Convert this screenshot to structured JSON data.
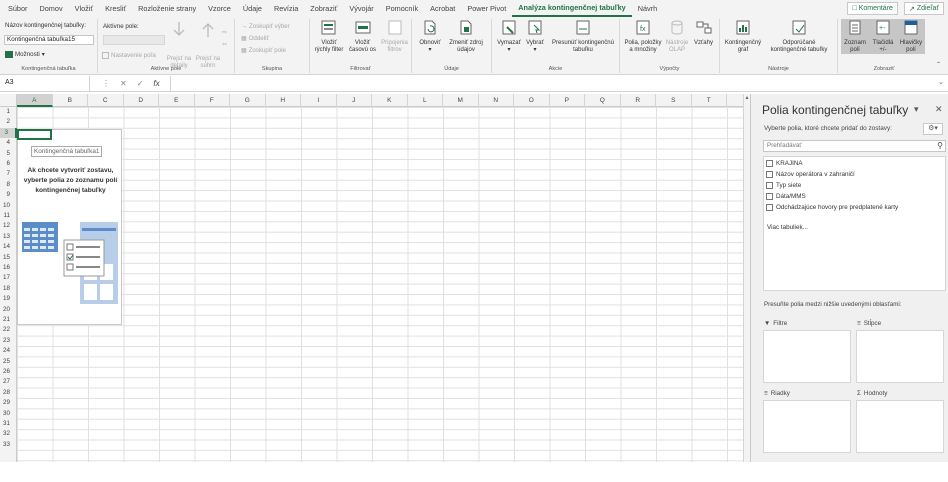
{
  "tabs": [
    "Súbor",
    "Domov",
    "Vložiť",
    "Kresliť",
    "Rozloženie strany",
    "Vzorce",
    "Údaje",
    "Revízia",
    "Zobraziť",
    "Vývojár",
    "Pomocník",
    "Acrobat",
    "Power Pivot",
    "Analýza kontingenčnej tabuľky",
    "Návrh"
  ],
  "active_tab": "Analýza kontingenčnej tabuľky",
  "comments_label": "Komentáre",
  "share_label": "Zdieľať",
  "accent_color": "#217346",
  "ribbon": {
    "pt_name_label": "Názov kontingenčnej tabuľky:",
    "pt_name_value": "Kontingenčná tabuľka15",
    "options_label": "Možnosti",
    "group_pivottable": "Kontingenčná tabuľka",
    "active_field_label": "Aktívne pole:",
    "field_settings": "Nastavenie poľa",
    "drill_down": "Prejsť na detaily",
    "drill_up": "Prejsť na súhrn",
    "group_active_field": "Aktívne pole",
    "group_selection": "Zoskupiť výber",
    "ungroup": "Oddeliť",
    "group_field": "Zoskupiť pole",
    "group_group": "Skupina",
    "insert_slicer": "Vložiť rýchly filter",
    "insert_timeline": "Vložiť časovú os",
    "filter_connections": "Pripojenia filtrov",
    "group_filter": "Filtrovať",
    "refresh": "Obnoviť",
    "change_source": "Zmeniť zdroj údajov",
    "group_data": "Údaje",
    "clear": "Vymazať",
    "select": "Vybrať",
    "move_pt": "Presunúť kontingenčnú tabuľku",
    "group_actions": "Akcie",
    "fields_items": "Polia, položky a množiny",
    "olap_tools": "Nástroje OLAP",
    "relationships": "Vzťahy",
    "group_calcs": "Výpočty",
    "pivotchart": "Kontingenčný graf",
    "recommended": "Odporúčané kontingenčné tabuľky",
    "group_tools": "Nástroje",
    "field_list": "Zoznam polí",
    "buttons": "Tlačidlá +/-",
    "headers": "Hlavičky polí",
    "group_show": "Zobraziť"
  },
  "formula": {
    "name_box": "A3",
    "fx": "fx"
  },
  "columns": [
    "A",
    "B",
    "C",
    "D",
    "E",
    "F",
    "G",
    "H",
    "I",
    "J",
    "K",
    "L",
    "M",
    "N",
    "O",
    "P",
    "Q",
    "R",
    "S",
    "T"
  ],
  "rows": [
    "1",
    "2",
    "3",
    "4",
    "5",
    "6",
    "7",
    "8",
    "9",
    "10",
    "11",
    "12",
    "13",
    "14",
    "15",
    "16",
    "17",
    "18",
    "19",
    "20",
    "21",
    "22",
    "23",
    "24",
    "25",
    "26",
    "27",
    "28",
    "29",
    "30",
    "31",
    "32",
    "33"
  ],
  "placeholder": {
    "name": "Kontingenčná tabuľka1",
    "message": "Ak chcete vytvoriť zostavu, vyberte polia zo zoznamu polí kontingenčnej tabuľky"
  },
  "pane": {
    "title": "Polia kontingenčnej tabuľky",
    "subtitle": "Vyberte polia, ktoré chcete pridať do zostavy:",
    "search_placeholder": "Prehľadávať",
    "fields": [
      "KRAJINA",
      "Názov operátora v zahraničí",
      "Typ siete",
      "Dáta/MMS",
      "Odchádzajúce hovory pre predplatené karty"
    ],
    "more_tables": "Viac tabuliek...",
    "drag_hint": "Presuňte polia medzi nižšie uvedenými oblasťami:",
    "filters": "Filtre",
    "columns_area": "Stĺpce",
    "rows_area": "Riadky",
    "values_area": "Hodnoty"
  }
}
